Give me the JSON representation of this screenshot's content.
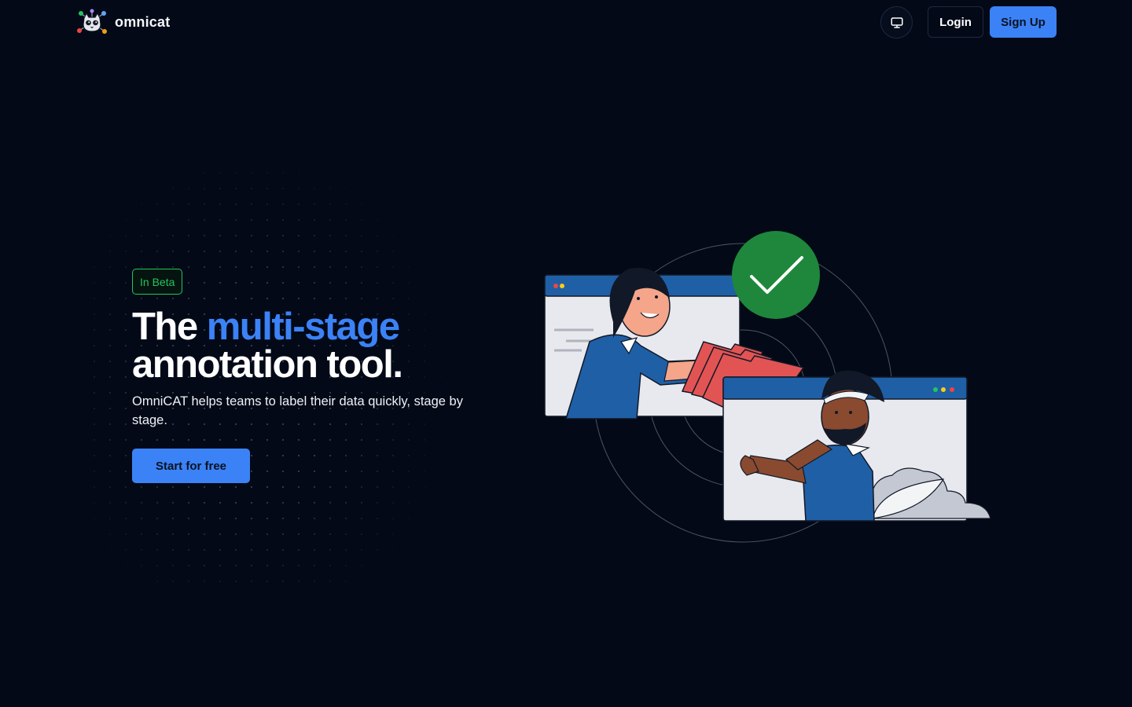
{
  "header": {
    "brand_name": "omnicat",
    "login_label": "Login",
    "signup_label": "Sign Up",
    "theme_toggle_icon": "monitor-icon"
  },
  "hero": {
    "badge": "In Beta",
    "title_prefix": "The ",
    "title_accent": "multi-stage",
    "title_line2": "annotation tool.",
    "subtitle": "OmniCAT helps teams to label their data quickly, stage by stage.",
    "cta_label": "Start for free"
  },
  "colors": {
    "background": "#030917",
    "accent": "#3b82f6",
    "beta_green": "#22c55e",
    "check_green": "#1e873b"
  },
  "illustration": {
    "icon": "data-handoff-illustration"
  }
}
